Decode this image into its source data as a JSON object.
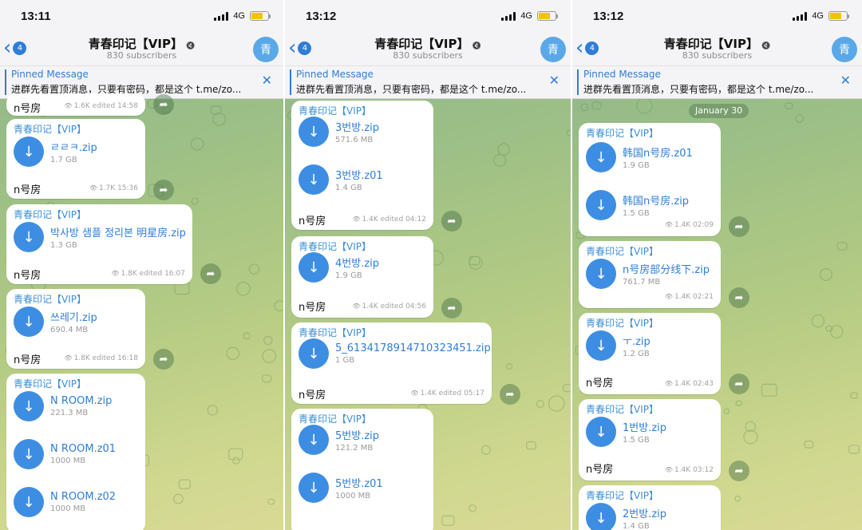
{
  "screens": [
    {
      "status_time": "13:11",
      "network": "4G",
      "back_badge": "4",
      "channel_title": "青春印记【VIP】",
      "subscribers": "830 subscribers",
      "avatar_letter": "青",
      "pinned_title": "Pinned Message",
      "pinned_text": "进群先看置顶消息，只要有密码，都是这个 t.me/zo...",
      "messages": [
        {
          "sender": "",
          "files": [],
          "caption": "n号房",
          "views": "1.6K",
          "edited": "edited",
          "time": "14:58"
        },
        {
          "sender": "青春印记【VIP】",
          "files": [
            {
              "name": "ㄹㄹㅋ.zip",
              "size": "1.7 GB"
            }
          ],
          "caption": "n号房",
          "views": "1.7K",
          "edited": "",
          "time": "15:36"
        },
        {
          "sender": "青春印记【VIP】",
          "files": [
            {
              "name": "박사방 샘플 정리본 明星房.zip",
              "size": "1.3 GB"
            }
          ],
          "caption": "n号房",
          "views": "1.8K",
          "edited": "edited",
          "time": "16:07"
        },
        {
          "sender": "青春印记【VIP】",
          "files": [
            {
              "name": "쓰레기.zip",
              "size": "690.4 MB"
            }
          ],
          "caption": "n号房",
          "views": "1.8K",
          "edited": "edited",
          "time": "16:18"
        },
        {
          "sender": "青春印记【VIP】",
          "files": [
            {
              "name": "N ROOM.zip",
              "size": "221.3 MB"
            },
            {
              "name": "N ROOM.z01",
              "size": "1000 MB"
            },
            {
              "name": "N ROOM.z02",
              "size": "1000 MB"
            }
          ],
          "caption": "",
          "views": "",
          "edited": "",
          "time": ""
        }
      ]
    },
    {
      "status_time": "13:12",
      "network": "4G",
      "back_badge": "4",
      "channel_title": "青春印记【VIP】",
      "subscribers": "830 subscribers",
      "avatar_letter": "青",
      "pinned_title": "Pinned Message",
      "pinned_text": "进群先看置顶消息，只要有密码，都是这个 t.me/zo...",
      "messages": [
        {
          "sender": "青春印记【VIP】",
          "files": [
            {
              "name": "3번방.zip",
              "size": "571.6 MB"
            },
            {
              "name": "3번방.z01",
              "size": "1.4 GB"
            }
          ],
          "caption": "n号房",
          "views": "1.4K",
          "edited": "edited",
          "time": "04:12"
        },
        {
          "sender": "青春印记【VIP】",
          "files": [
            {
              "name": "4번방.zip",
              "size": "1.9 GB"
            }
          ],
          "caption": "n号房",
          "views": "1.4K",
          "edited": "edited",
          "time": "04:56"
        },
        {
          "sender": "青春印记【VIP】",
          "files": [
            {
              "name": "5_6134178914710323451.zip",
              "size": "1 GB"
            }
          ],
          "caption": "n号房",
          "views": "1.4K",
          "edited": "edited",
          "time": "05:17"
        },
        {
          "sender": "青春印记【VIP】",
          "files": [
            {
              "name": "5번방.zip",
              "size": "121.2 MB"
            },
            {
              "name": "5번방.z01",
              "size": "1000 MB"
            }
          ],
          "caption": "",
          "views": "",
          "edited": "",
          "time": ""
        }
      ]
    },
    {
      "status_time": "13:12",
      "network": "4G",
      "back_badge": "4",
      "channel_title": "青春印记【VIP】",
      "subscribers": "830 subscribers",
      "avatar_letter": "青",
      "pinned_title": "Pinned Message",
      "pinned_text": "进群先看置顶消息，只要有密码，都是这个 t.me/zo...",
      "date_chip": "January 30",
      "messages": [
        {
          "sender": "青春印记【VIP】",
          "files": [
            {
              "name": "韩国n号房.z01",
              "size": "1.9 GB"
            },
            {
              "name": "韩国n号房.zip",
              "size": "1.5 GB"
            }
          ],
          "caption": "",
          "views": "1.4K",
          "edited": "",
          "time": "02:09"
        },
        {
          "sender": "青春印记【VIP】",
          "files": [
            {
              "name": "n号房部分线下.zip",
              "size": "761.7 MB"
            }
          ],
          "caption": "",
          "views": "1.4K",
          "edited": "",
          "time": "02:21"
        },
        {
          "sender": "青春印记【VIP】",
          "files": [
            {
              "name": "ㅜ.zip",
              "size": "1.2 GB"
            }
          ],
          "caption": "n号房",
          "views": "1.4K",
          "edited": "",
          "time": "02:43"
        },
        {
          "sender": "青春印记【VIP】",
          "files": [
            {
              "name": "1번방.zip",
              "size": "1.5 GB"
            }
          ],
          "caption": "n号房",
          "views": "1.4K",
          "edited": "",
          "time": "03:12"
        },
        {
          "sender": "青春印记【VIP】",
          "files": [
            {
              "name": "2번방.zip",
              "size": "1.4 GB"
            }
          ],
          "caption": "",
          "views": "",
          "edited": "",
          "time": ""
        }
      ]
    }
  ],
  "icons": {
    "back": "chevron-left-icon",
    "download": "download-arrow-icon",
    "share": "forward-share-icon",
    "views": "eye-icon",
    "close": "close-icon",
    "mute": "muted-speaker-icon"
  },
  "colors": {
    "accent": "#2f7dd6",
    "download_button": "#3d8ee3",
    "avatar": "#5aa8e8",
    "battery": "#f0c400"
  }
}
